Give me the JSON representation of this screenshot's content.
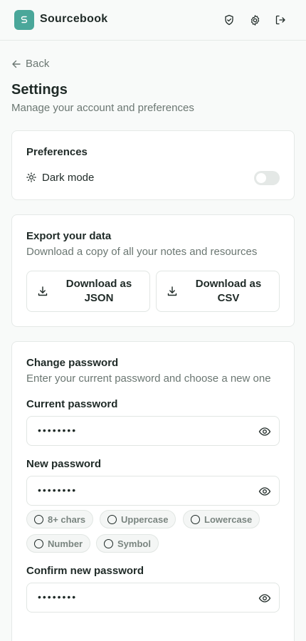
{
  "app": {
    "name": "Sourcebook"
  },
  "header": {
    "icons": [
      "shield-check-icon",
      "gear-icon",
      "logout-icon"
    ]
  },
  "nav": {
    "back_label": "Back"
  },
  "page": {
    "title": "Settings",
    "subtitle": "Manage your account and preferences"
  },
  "preferences": {
    "title": "Preferences",
    "dark_mode_label": "Dark mode",
    "dark_mode_enabled": false
  },
  "export": {
    "title": "Export your data",
    "description": "Download a copy of all your notes and resources",
    "json_label": "Download as JSON",
    "csv_label": "Download as CSV"
  },
  "password": {
    "title": "Change password",
    "description": "Enter your current password and choose a new one",
    "current_label": "Current password",
    "current_value": "••••••••",
    "new_label": "New password",
    "new_value": "••••••••",
    "confirm_label": "Confirm new password",
    "confirm_value": "••••••••",
    "requirements": [
      "8+ chars",
      "Uppercase",
      "Lowercase",
      "Number",
      "Symbol"
    ]
  },
  "colors": {
    "accent": "#4aa79a",
    "text": "#1f2a27",
    "muted": "#6b7772",
    "border": "#e5e9e7"
  }
}
